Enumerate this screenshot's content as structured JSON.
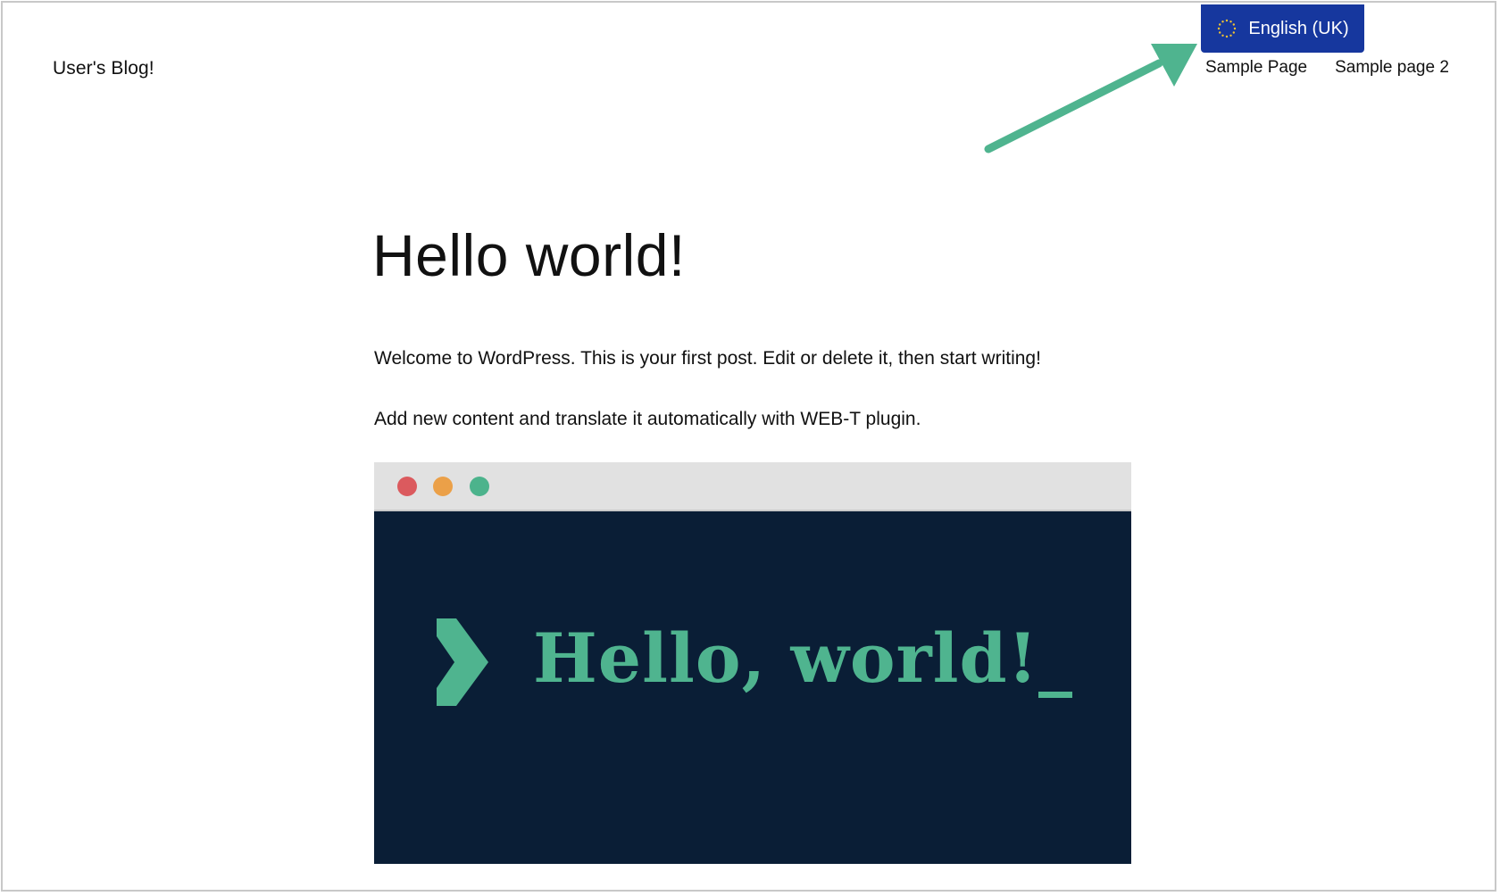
{
  "site": {
    "title": "User's Blog!"
  },
  "language_switcher": {
    "label": "English (UK)",
    "icon": "eu-flag-icon",
    "color": "#16379e"
  },
  "nav": {
    "items": [
      {
        "label": "Sample Page"
      },
      {
        "label": "Sample page 2"
      }
    ]
  },
  "annotation": {
    "arrow_color": "#4fb48f"
  },
  "post": {
    "title": "Hello world!",
    "paragraphs": [
      "Welcome to WordPress. This is your first post. Edit or delete it, then start writing!",
      "Add new content and translate it automatically with WEB-T plugin."
    ]
  },
  "hero_image": {
    "text": "Hello, world!_",
    "background": "#0a1e36",
    "accent": "#4fb48f",
    "window_dots": [
      "#db5a5e",
      "#eba048",
      "#4cb38c"
    ]
  }
}
